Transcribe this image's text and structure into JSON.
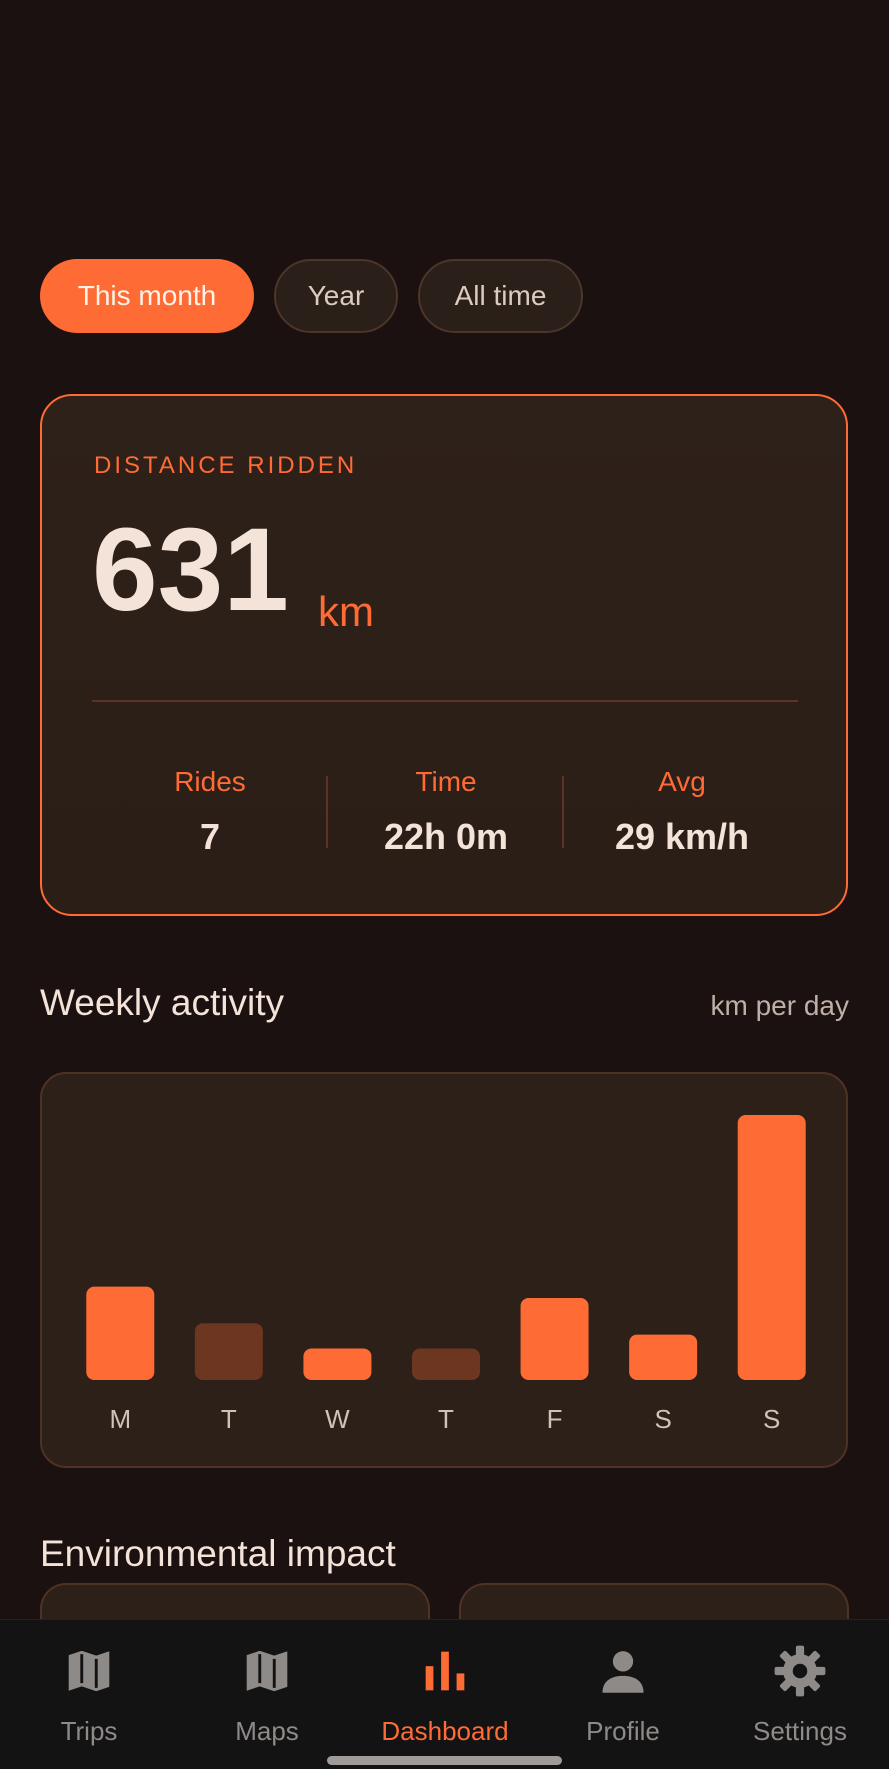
{
  "filters": [
    {
      "label": "This month",
      "active": true
    },
    {
      "label": "Year",
      "active": false
    },
    {
      "label": "All time",
      "active": false
    }
  ],
  "distance": {
    "label": "DISTANCE RIDDEN",
    "value": "631",
    "unit": "km",
    "stats": [
      {
        "label": "Rides",
        "value": "7"
      },
      {
        "label": "Time",
        "value": "22h 0m"
      },
      {
        "label": "Avg",
        "value": "29 km/h"
      }
    ]
  },
  "weekly": {
    "title": "Weekly activity",
    "meta": "km per day"
  },
  "environment": {
    "title": "Environmental impact"
  },
  "chart_data": {
    "type": "bar",
    "categories": [
      "M",
      "T",
      "W",
      "T",
      "F",
      "S",
      "S"
    ],
    "values": [
      74,
      45,
      25,
      25,
      65,
      36,
      210
    ],
    "highlighted": [
      true,
      false,
      true,
      false,
      true,
      true,
      true
    ],
    "ylim": [
      0,
      210
    ],
    "grid": false,
    "colors": {
      "active": "#ff6b35",
      "inactive": "#6d3620",
      "label": "#cfc2b8"
    }
  },
  "nav": [
    {
      "label": "Trips",
      "icon": "map-icon",
      "active": false
    },
    {
      "label": "Maps",
      "icon": "map-icon",
      "active": false
    },
    {
      "label": "Dashboard",
      "icon": "bar-chart-icon",
      "active": true
    },
    {
      "label": "Profile",
      "icon": "person-icon",
      "active": false
    },
    {
      "label": "Settings",
      "icon": "gear-icon",
      "active": false
    }
  ],
  "theme": {
    "accent": "#ff6b35",
    "background": "#1a1110",
    "card": "#2a1e18",
    "text": "#f3e3d9"
  }
}
